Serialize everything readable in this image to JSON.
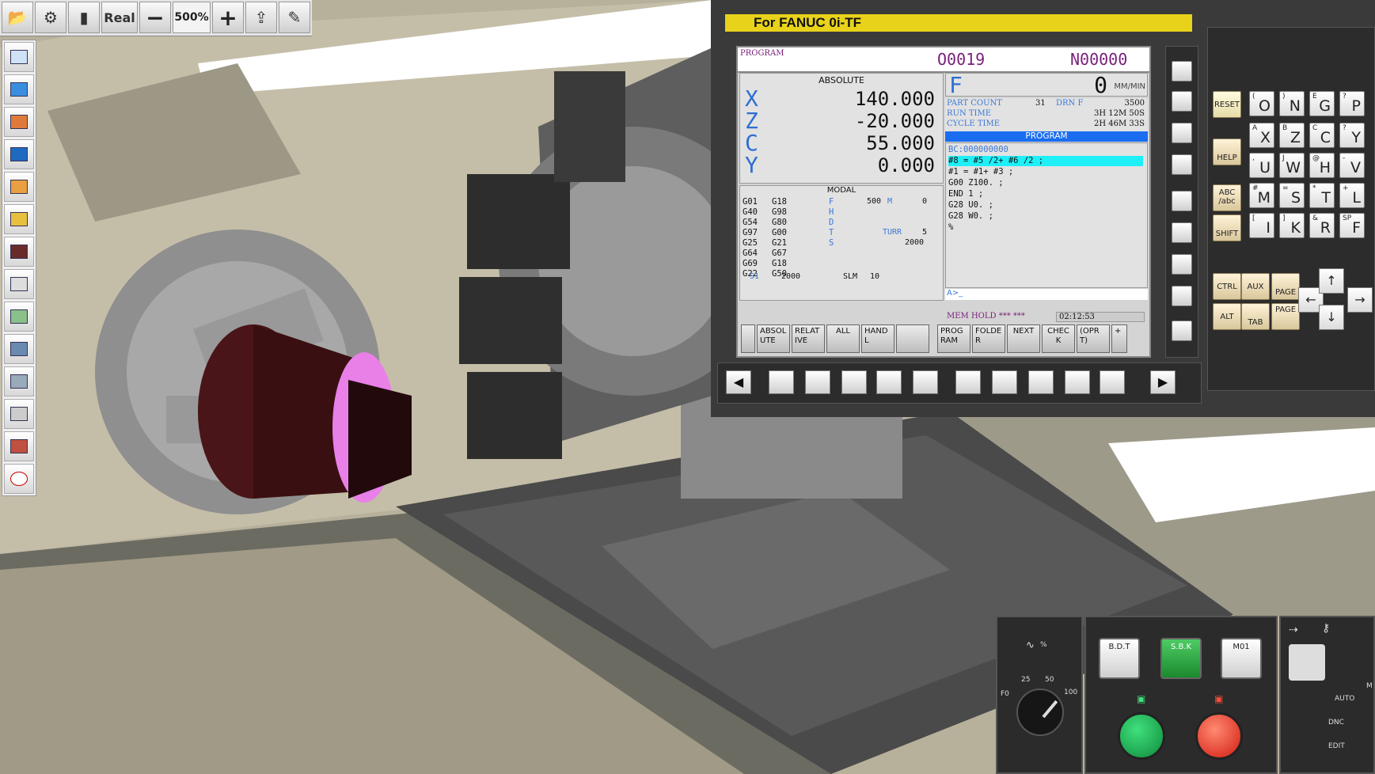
{
  "toolbar": {
    "real_label": "Real",
    "minus_label": "−",
    "zoom": "500%",
    "plus_label": "+"
  },
  "panel": {
    "banner": "For FANUC 0i-TF",
    "screen": {
      "program_label": "PROGRAM",
      "o_number": "O0019",
      "n_number": "N00000",
      "absolute_title": "ABSOLUTE",
      "axes": [
        {
          "name": "X",
          "value": "140.000"
        },
        {
          "name": "Z",
          "value": "-20.000"
        },
        {
          "name": "C",
          "value": "55.000"
        },
        {
          "name": "Y",
          "value": "0.000"
        }
      ],
      "modal_title": "MODAL",
      "gcodes_col1": [
        "G01",
        "G40",
        "G54",
        "G97",
        "G25",
        "G64",
        "G69",
        "G22"
      ],
      "gcodes_col2": [
        "G18",
        "G98",
        "G80",
        "G00",
        "G21",
        "G67",
        "G18",
        "G50"
      ],
      "modal_letters": [
        "F",
        "H",
        "D",
        "T",
        "S"
      ],
      "modal_f": "500",
      "modal_m_label": "M",
      "modal_m_value": "0",
      "turr_label": "TURR",
      "turr_value": "5",
      "s_value": "2000",
      "s1_label": "S1",
      "s1_value": "2000",
      "slm_label": "SLM",
      "slm_value": "10",
      "feed_label": "F",
      "feed_value": "0",
      "feed_unit": "MM/MIN",
      "part_count_label": "PART COUNT",
      "part_count_value": "31",
      "drn_label": "DRN F",
      "drn_value": "3500",
      "run_time_label": "RUN TIME",
      "run_time_value": "3H 12M 50S",
      "cycle_time_label": "CYCLE TIME",
      "cycle_time_value": "2H 46M 33S",
      "program_header": "PROGRAM",
      "program_lines": [
        "BC:000000000",
        "#8 = #5 /2+ #6 /2 ;",
        "#1 = #1+ #3 ;",
        "G00 Z100. ;",
        "END 1 ;",
        "G28 U0. ;",
        "G28 W0. ;",
        "%"
      ],
      "prompt": "A>_",
      "status_mode": "MEM HOLD *** ***",
      "status_time": "02:12:53",
      "softkeys": [
        "ABSOLUTE",
        "RELATIVE",
        "ALL",
        "HANDL",
        "",
        "PROGRAM",
        "FOLDER",
        "NEXT",
        "CHECK",
        "(OPRT)",
        "+"
      ]
    },
    "keypad": {
      "reset": "RESET",
      "help": "HELP",
      "abc": "ABC /abc",
      "shift": "SHIFT",
      "ctrl": "CTRL",
      "aux": "AUX",
      "alt": "ALT",
      "tab": "TAB",
      "page_up": "PAGE",
      "page_down": "PAGE",
      "keys": [
        {
          "sub": "(",
          "main": "O"
        },
        {
          "sub": ")",
          "main": "N"
        },
        {
          "sub": "E",
          "main": "G"
        },
        {
          "sub": "?",
          "main": "P"
        },
        {
          "sub": "A",
          "main": "X"
        },
        {
          "sub": "B",
          "main": "Z"
        },
        {
          "sub": "C",
          "main": "C"
        },
        {
          "sub": "?",
          "main": "Y"
        },
        {
          "sub": ",",
          "main": "U"
        },
        {
          "sub": "J",
          "main": "W"
        },
        {
          "sub": "@",
          "main": "H"
        },
        {
          "sub": "-",
          "main": "V"
        },
        {
          "sub": "#",
          "main": "M"
        },
        {
          "sub": "=",
          "main": "S"
        },
        {
          "sub": "*",
          "main": "T"
        },
        {
          "sub": "+",
          "main": "L"
        },
        {
          "sub": "[",
          "main": "I"
        },
        {
          "sub": "]",
          "main": "K"
        },
        {
          "sub": "&",
          "main": "R"
        },
        {
          "sub": "SP",
          "main": "F"
        }
      ]
    }
  },
  "operator": {
    "feed_override_label": "%",
    "dial_ticks": [
      "F0",
      "25",
      "50",
      "100"
    ],
    "bdt": "B.D.T",
    "sbk": "S.B.K",
    "m01": "M01",
    "modes": [
      "AUTO",
      "DNC",
      "EDIT"
    ],
    "mode_cut": "M"
  }
}
